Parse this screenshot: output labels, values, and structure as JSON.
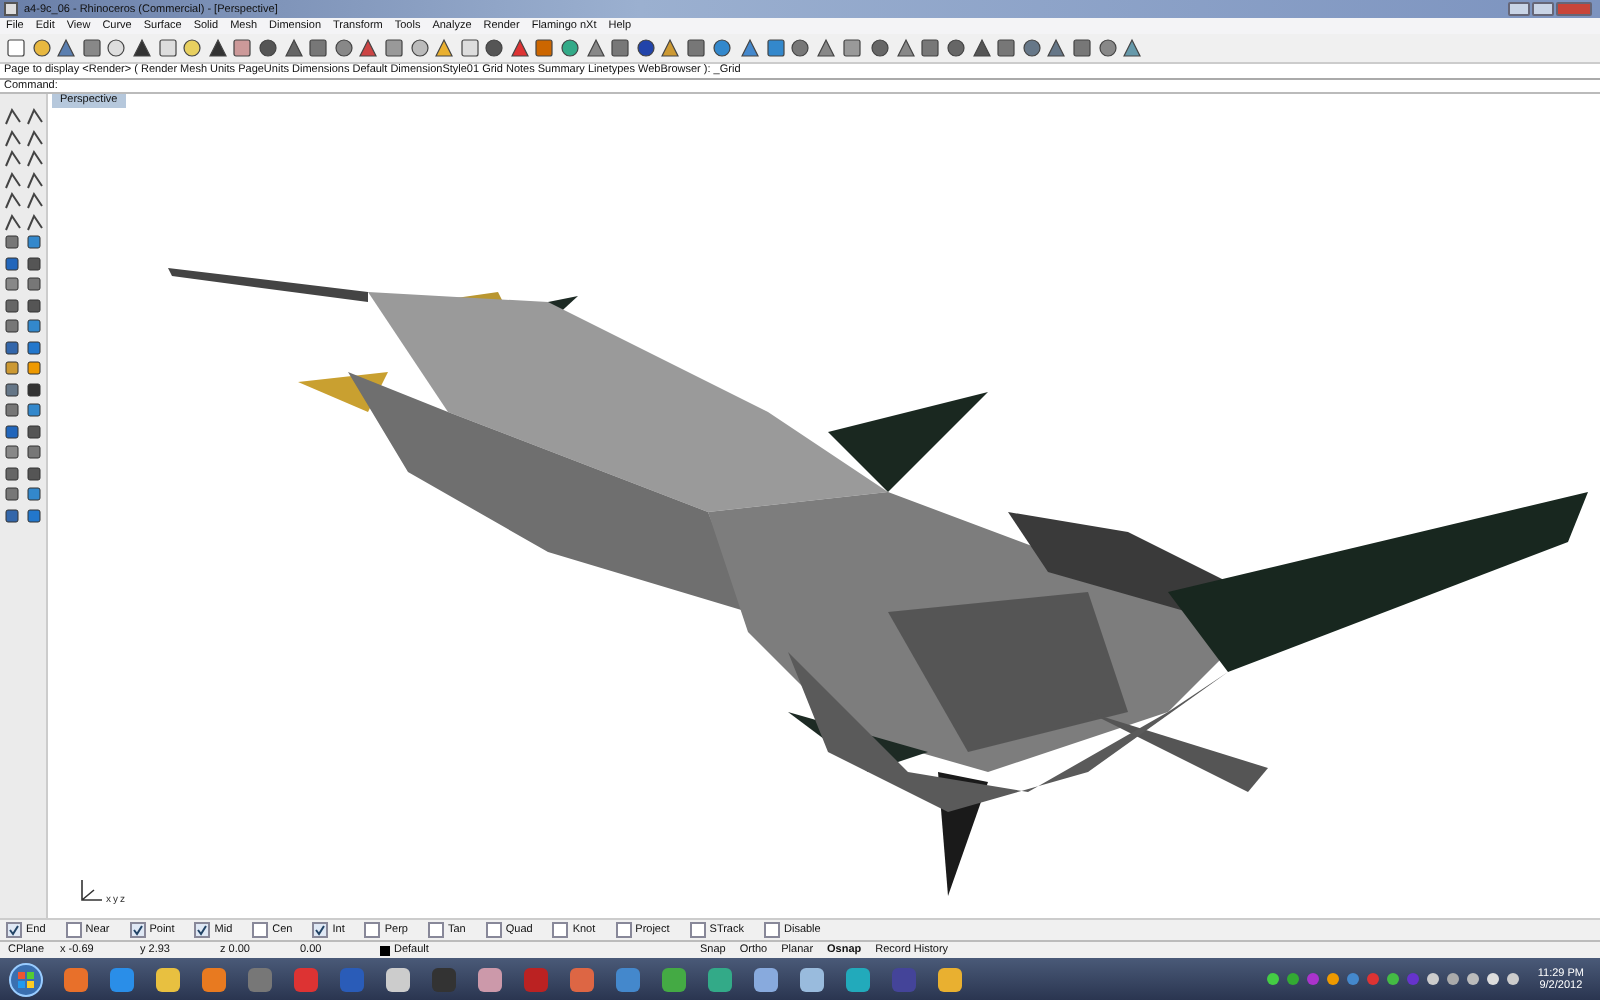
{
  "window": {
    "title": "a4-9c_06 - Rhinoceros (Commercial) - [Perspective]"
  },
  "menu": [
    "File",
    "Edit",
    "View",
    "Curve",
    "Surface",
    "Solid",
    "Mesh",
    "Dimension",
    "Transform",
    "Tools",
    "Analyze",
    "Render",
    "Flamingo nXt",
    "Help"
  ],
  "command_history": "Page to display <Render> ( Render Mesh Units PageUnits Dimensions Default DimensionStyle01 Grid Notes Summary Linetypes WebBrowser ): _Grid",
  "command_prompt": "Command:",
  "viewport": {
    "tab": {
      "label": "Perspective",
      "selected": true
    },
    "axes": [
      "x",
      "y",
      "z"
    ]
  },
  "osnaps": [
    {
      "label": "End",
      "checked": true
    },
    {
      "label": "Near",
      "checked": false
    },
    {
      "label": "Point",
      "checked": true
    },
    {
      "label": "Mid",
      "checked": true
    },
    {
      "label": "Cen",
      "checked": false
    },
    {
      "label": "Int",
      "checked": true
    },
    {
      "label": "Perp",
      "checked": false
    },
    {
      "label": "Tan",
      "checked": false
    },
    {
      "label": "Quad",
      "checked": false
    },
    {
      "label": "Knot",
      "checked": false
    },
    {
      "label": "Project",
      "checked": false
    },
    {
      "label": "STrack",
      "checked": false
    },
    {
      "label": "Disable",
      "checked": false
    }
  ],
  "status_bar": {
    "cplane": "CPlane",
    "x": "x -0.69",
    "y": "y 2.93",
    "z": "z 0.00",
    "distance": "0.00",
    "layer": {
      "name": "Default",
      "color": "#000000"
    },
    "panes": [
      {
        "label": "Snap",
        "on": false
      },
      {
        "label": "Ortho",
        "on": false
      },
      {
        "label": "Planar",
        "on": false
      },
      {
        "label": "Osnap",
        "on": true
      },
      {
        "label": "Record History",
        "on": false
      }
    ]
  },
  "taskbar": {
    "time": "11:29 PM",
    "date": "9/2/2012"
  }
}
